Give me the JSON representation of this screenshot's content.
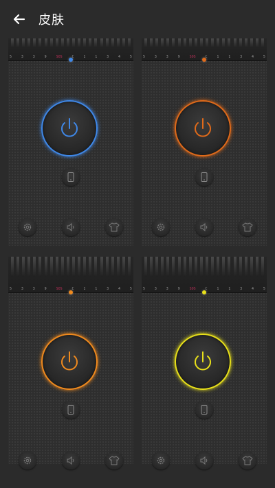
{
  "header": {
    "title": "皮肤",
    "back_icon": "arrow-left-icon"
  },
  "ruler": {
    "numbers": [
      "5",
      "3",
      "3",
      "9",
      "SOS",
      "C",
      "1",
      "1",
      "3",
      "4",
      "5"
    ]
  },
  "skins": [
    {
      "id": "blue",
      "accent": "#3f88e8"
    },
    {
      "id": "orange-red",
      "accent": "#e06a1a"
    },
    {
      "id": "orange",
      "accent": "#f08a1e"
    },
    {
      "id": "yellow",
      "accent": "#e8e01a"
    }
  ],
  "card_icons": [
    "power-icon",
    "phone-icon",
    "gear-icon",
    "speaker-icon",
    "shirt-icon"
  ]
}
